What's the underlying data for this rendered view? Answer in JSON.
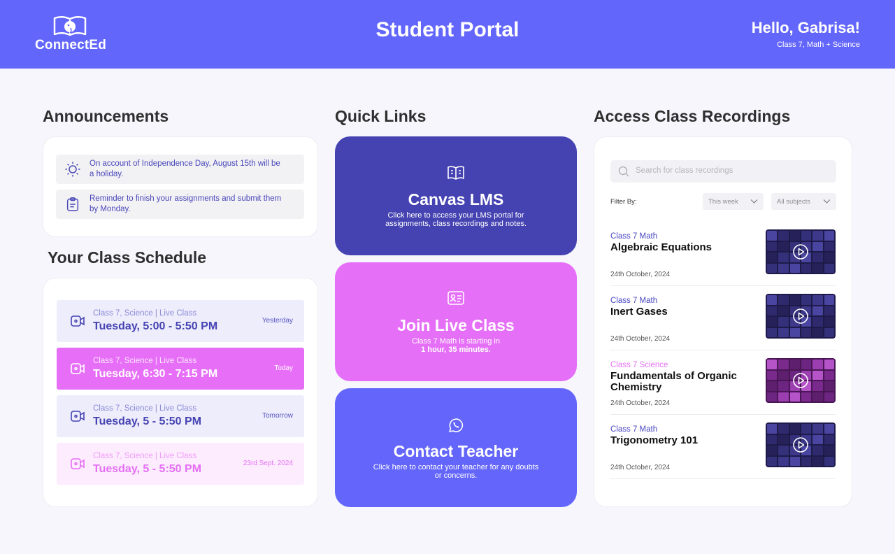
{
  "header": {
    "logo_text": "ConnectEd",
    "title": "Student Portal",
    "greeting": "Hello, Gabrisa!",
    "subtitle": "Class 7, Math + Science"
  },
  "announcements": {
    "title": "Announcements",
    "items": [
      {
        "icon": "sun-icon",
        "text": "On account of Independence Day, August 15th will be a holiday."
      },
      {
        "icon": "clipboard-icon",
        "text": "Reminder to finish your assignments and submit them by Monday."
      }
    ]
  },
  "schedule": {
    "title": "Your Class Schedule",
    "items": [
      {
        "meta": "Class 7, Science | Live Class",
        "time": "Tuesday, 5:00 - 5:50 PM",
        "when": "Yesterday",
        "style": "light"
      },
      {
        "meta": "Class 7, Science | Live Class",
        "time": "Tuesday, 6:30 - 7:15 PM",
        "when": "Today",
        "style": "active"
      },
      {
        "meta": "Class 7, Science | Live Class",
        "time": "Tuesday, 5 - 5:50 PM",
        "when": "Tomorrow",
        "style": "light"
      },
      {
        "meta": "Class 7, Science | Live Class",
        "time": "Tuesday, 5 - 5:50 PM",
        "when": "23rd Sept.  2024",
        "style": "pink"
      }
    ]
  },
  "quick_links": {
    "title": "Quick Links",
    "items": [
      {
        "icon": "book-icon",
        "title": "Canvas LMS",
        "desc": "Click here to access your LMS portal for assignments, class recordings and notes.",
        "desc_bold": "",
        "color": "#4543b1"
      },
      {
        "icon": "id-card-icon",
        "title": "Join Live Class",
        "desc": "Class 7 Math is starting in",
        "desc_bold": "1 hour, 35 minutes.",
        "color": "#e66ff7"
      },
      {
        "icon": "whatsapp-icon",
        "title": "Contact Teacher",
        "desc": "Click here to contact your teacher for any doubts or concerns.",
        "desc_bold": "",
        "color": "#6466fb"
      }
    ]
  },
  "recordings": {
    "title": "Access Class Recordings",
    "search_placeholder": "Search for class recordings",
    "filter_label": "Filter By:",
    "filter_time": "This week",
    "filter_subject": "All subjects",
    "items": [
      {
        "subject": "Class 7 Math",
        "title": "Algebraic Equations",
        "date": "24th October, 2024",
        "type": "math"
      },
      {
        "subject": "Class 7 Math",
        "title": "Inert Gases",
        "date": "24th October, 2024",
        "type": "math"
      },
      {
        "subject": "Class 7 Science",
        "title": "Fundamentals of Organic Chemistry",
        "date": "24th October, 2024",
        "type": "sci"
      },
      {
        "subject": "Class 7 Math",
        "title": "Trigonometry 101",
        "date": "24th October, 2024",
        "type": "math"
      }
    ]
  },
  "colors": {
    "primary": "#6366fa",
    "dark_indigo": "#4543b1",
    "pink": "#e66ff7"
  }
}
